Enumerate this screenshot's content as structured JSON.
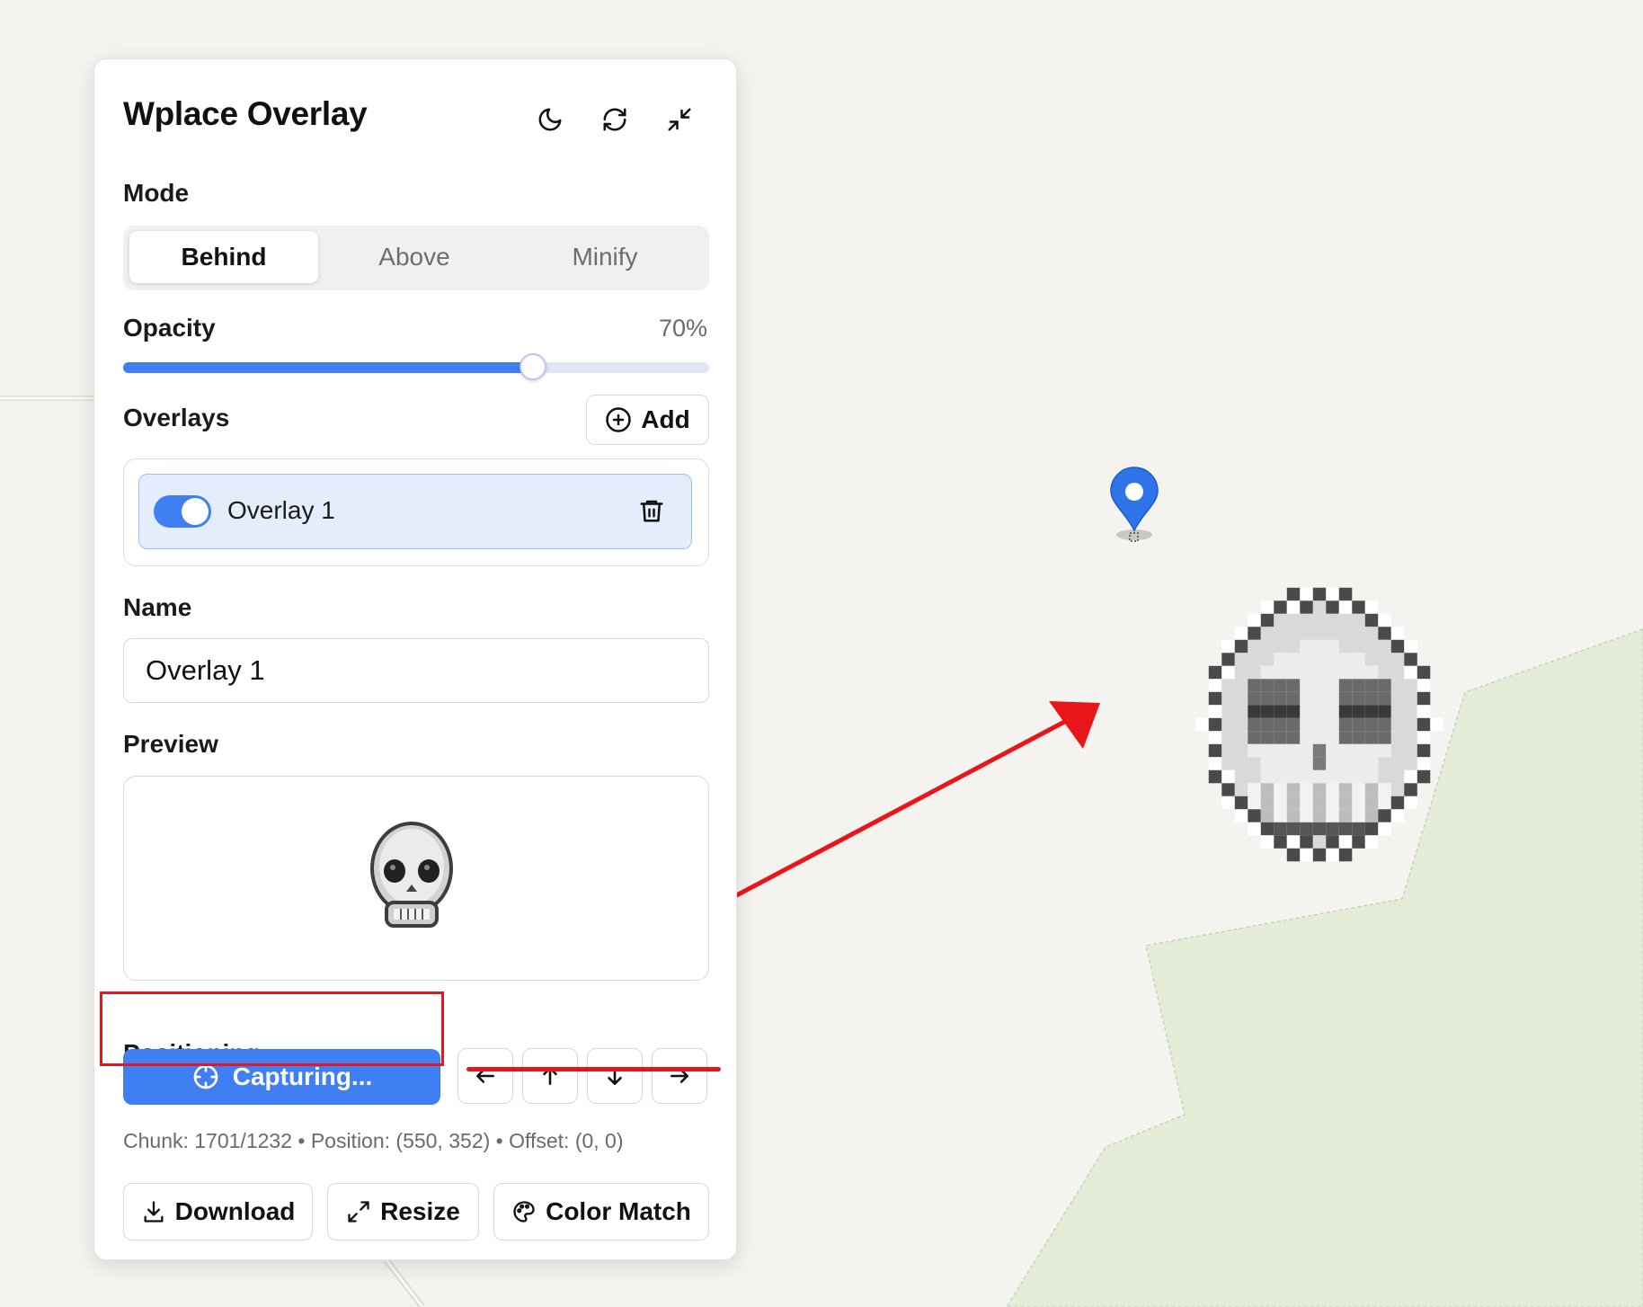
{
  "app": {
    "title": "Wplace Overlay"
  },
  "header": {
    "theme_icon": "moon-icon",
    "refresh_icon": "refresh-icon",
    "collapse_icon": "minimize-icon"
  },
  "mode": {
    "label": "Mode",
    "options": [
      "Behind",
      "Above",
      "Minify"
    ],
    "selected": "Behind"
  },
  "opacity": {
    "label": "Opacity",
    "value_text": "70%",
    "value": 0.7
  },
  "overlays": {
    "label": "Overlays",
    "add_label": "Add",
    "items": [
      {
        "name": "Overlay 1",
        "enabled": true
      }
    ]
  },
  "name": {
    "label": "Name",
    "value": "Overlay 1"
  },
  "preview": {
    "label": "Preview"
  },
  "positioning": {
    "label": "Positioning",
    "capture_label": "Capturing...",
    "status_text": "Chunk: 1701/1232 • Position: (550, 352) • Offset: (0, 0)"
  },
  "actions": {
    "download": "Download",
    "resize": "Resize",
    "color_match": "Color Match"
  },
  "colors": {
    "accent": "#3f7ef3",
    "annotation": "#e8161b",
    "map_background": "#f5f3ef",
    "map_park": "#e4ecd8"
  }
}
